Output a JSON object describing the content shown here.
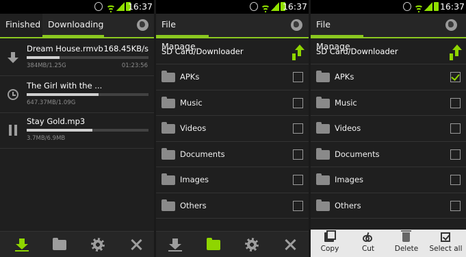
{
  "status": {
    "time": "16:37"
  },
  "panel1": {
    "tabs": [
      "Finished",
      "Downloading"
    ],
    "downloads": [
      {
        "name": "Dream House.rmvb",
        "speed": "168.45KB/s",
        "size": "384MB/1.25G",
        "eta": "01:23:56",
        "progress": 0.27
      },
      {
        "name": "The Girl with the ...",
        "speed": "",
        "size": "647.37MB/1.09G",
        "eta": "",
        "progress": 0.59
      },
      {
        "name": "Stay Gold.mp3",
        "speed": "",
        "size": "3.7MB/6.9MB",
        "eta": "",
        "progress": 0.54
      }
    ]
  },
  "panel2": {
    "tab": "File Manage",
    "path": "SD Card/Downloader",
    "folders": [
      "APKs",
      "Music",
      "Videos",
      "Documents",
      "Images",
      "Others"
    ]
  },
  "panel3": {
    "tab": "File Manage",
    "path": "SD Card/Downloader",
    "folders": [
      "APKs",
      "Music",
      "Videos",
      "Documents",
      "Images",
      "Others"
    ],
    "checked": [
      true,
      false,
      false,
      false,
      false,
      false
    ],
    "actions": [
      "Copy",
      "Cut",
      "Delete",
      "Select all"
    ]
  },
  "icons": {
    "accent": "#8fd500"
  }
}
